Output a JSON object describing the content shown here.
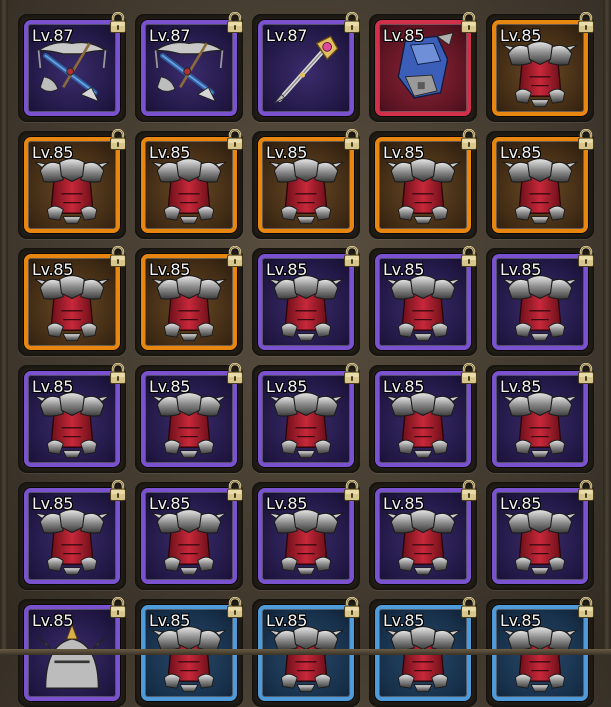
{
  "inventory": {
    "items": [
      {
        "level": "Lv.87",
        "rarity": "purple",
        "type": "crossbow",
        "locked": true
      },
      {
        "level": "Lv.87",
        "rarity": "purple",
        "type": "crossbow",
        "locked": true
      },
      {
        "level": "Lv.87",
        "rarity": "purple",
        "type": "staff",
        "locked": true
      },
      {
        "level": "Lv.85",
        "rarity": "red",
        "type": "gauntlet",
        "locked": true
      },
      {
        "level": "Lv.85",
        "rarity": "orange",
        "type": "armor",
        "locked": true
      },
      {
        "level": "Lv.85",
        "rarity": "orange",
        "type": "armor",
        "locked": true
      },
      {
        "level": "Lv.85",
        "rarity": "orange",
        "type": "armor",
        "locked": true
      },
      {
        "level": "Lv.85",
        "rarity": "orange",
        "type": "armor",
        "locked": true
      },
      {
        "level": "Lv.85",
        "rarity": "orange",
        "type": "armor",
        "locked": true
      },
      {
        "level": "Lv.85",
        "rarity": "orange",
        "type": "armor",
        "locked": true
      },
      {
        "level": "Lv.85",
        "rarity": "orange",
        "type": "armor",
        "locked": true
      },
      {
        "level": "Lv.85",
        "rarity": "orange",
        "type": "armor",
        "locked": true
      },
      {
        "level": "Lv.85",
        "rarity": "purple",
        "type": "armor",
        "locked": true
      },
      {
        "level": "Lv.85",
        "rarity": "purple",
        "type": "armor",
        "locked": true
      },
      {
        "level": "Lv.85",
        "rarity": "purple",
        "type": "armor",
        "locked": true
      },
      {
        "level": "Lv.85",
        "rarity": "purple",
        "type": "armor",
        "locked": true
      },
      {
        "level": "Lv.85",
        "rarity": "purple",
        "type": "armor",
        "locked": true
      },
      {
        "level": "Lv.85",
        "rarity": "purple",
        "type": "armor",
        "locked": true
      },
      {
        "level": "Lv.85",
        "rarity": "purple",
        "type": "armor",
        "locked": true
      },
      {
        "level": "Lv.85",
        "rarity": "purple",
        "type": "armor",
        "locked": true
      },
      {
        "level": "Lv.85",
        "rarity": "purple",
        "type": "armor",
        "locked": true
      },
      {
        "level": "Lv.85",
        "rarity": "purple",
        "type": "armor",
        "locked": true
      },
      {
        "level": "Lv.85",
        "rarity": "purple",
        "type": "armor",
        "locked": true
      },
      {
        "level": "Lv.85",
        "rarity": "purple",
        "type": "armor",
        "locked": true
      },
      {
        "level": "Lv.85",
        "rarity": "purple",
        "type": "armor",
        "locked": true
      },
      {
        "level": "Lv.85",
        "rarity": "purple",
        "type": "helmet",
        "locked": true
      },
      {
        "level": "Lv.85",
        "rarity": "blue",
        "type": "armor",
        "locked": true
      },
      {
        "level": "Lv.85",
        "rarity": "blue",
        "type": "armor",
        "locked": true
      },
      {
        "level": "Lv.85",
        "rarity": "blue",
        "type": "armor",
        "locked": true
      },
      {
        "level": "Lv.85",
        "rarity": "blue",
        "type": "armor",
        "locked": true
      }
    ]
  },
  "rarity_colors": {
    "purple": "#7a52d0",
    "orange": "#e8860f",
    "red": "#d22f4a",
    "blue": "#4f9ad8"
  },
  "icons": {
    "lock": "padlock-icon",
    "crossbow": "crossbow-icon",
    "staff": "staff-icon",
    "gauntlet": "gauntlet-icon",
    "armor": "chest-armor-icon",
    "helmet": "helmet-icon"
  }
}
